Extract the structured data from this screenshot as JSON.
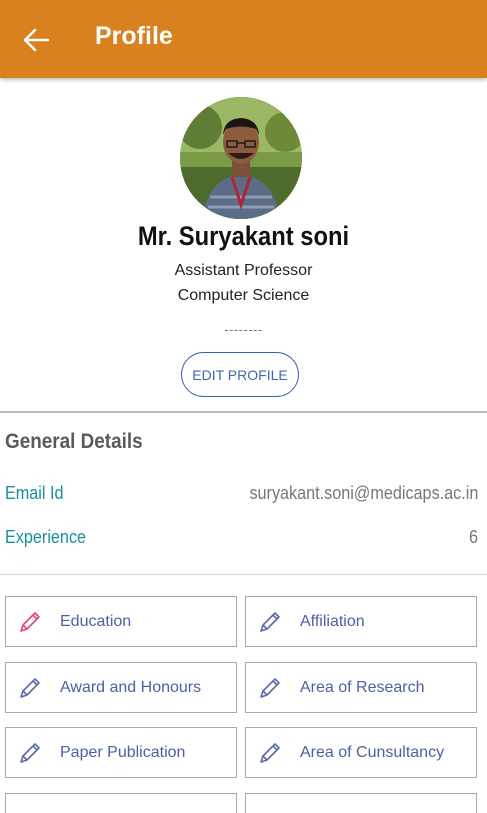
{
  "appbar": {
    "title": "Profile",
    "back_icon": "arrow-left-icon",
    "background": "#d8811e"
  },
  "profile": {
    "name": "Mr. Suryakant soni",
    "designation": "Assistant Professor",
    "department": "Computer Science",
    "separator": "--------",
    "edit_label": "EDIT PROFILE"
  },
  "general": {
    "title": "General Details",
    "email_label": "Email Id",
    "email_value": "suryakant.soni@medicaps.ac.in",
    "experience_label": "Experience",
    "experience_value": "6"
  },
  "tiles": [
    {
      "label": "Education",
      "icon": "pencil-icon",
      "icon_color": "#e0457a"
    },
    {
      "label": "Affiliation",
      "icon": "pencil-icon",
      "icon_color": "#5a6ba8"
    },
    {
      "label": "Award and Honours",
      "icon": "pencil-icon",
      "icon_color": "#5a6ba8"
    },
    {
      "label": "Area of Research",
      "icon": "pencil-icon",
      "icon_color": "#5a6ba8"
    },
    {
      "label": "Paper Publication",
      "icon": "pencil-icon",
      "icon_color": "#5a6ba8"
    },
    {
      "label": "Area of Cunsultancy",
      "icon": "pencil-icon",
      "icon_color": "#5a6ba8"
    }
  ]
}
